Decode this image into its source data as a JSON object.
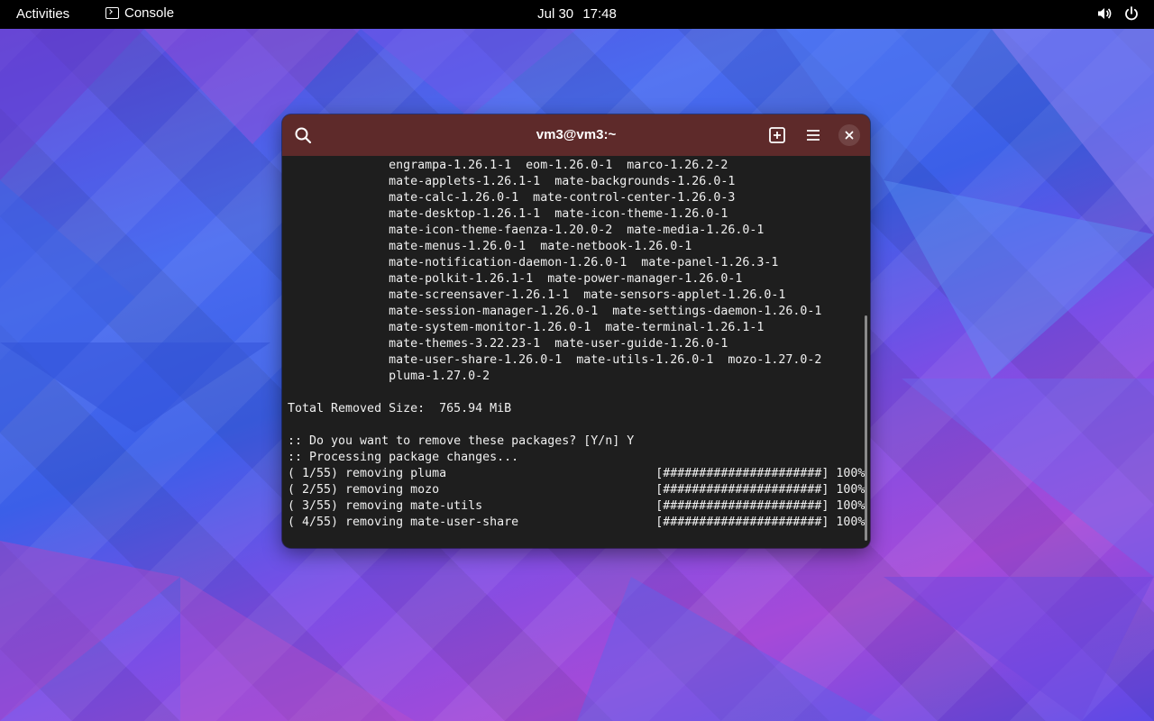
{
  "topbar": {
    "activities": "Activities",
    "app_name": "Console",
    "date": "Jul 30",
    "time": "17:48"
  },
  "icons": {
    "console": "terminal-icon",
    "volume": "speaker-icon",
    "power": "power-icon",
    "search": "magnifier-icon",
    "new_tab": "plus-square-icon",
    "menu": "hamburger-icon",
    "close": "x-icon"
  },
  "colors": {
    "headerbar": "#5e2a2a",
    "terminal_bg": "#1e1e1e",
    "terminal_fg": "#f0f0f0"
  },
  "window": {
    "title": "vm3@vm3:~"
  },
  "terminal": {
    "lines": [
      "              engrampa-1.26.1-1  eom-1.26.0-1  marco-1.26.2-2",
      "              mate-applets-1.26.1-1  mate-backgrounds-1.26.0-1",
      "              mate-calc-1.26.0-1  mate-control-center-1.26.0-3",
      "              mate-desktop-1.26.1-1  mate-icon-theme-1.26.0-1",
      "              mate-icon-theme-faenza-1.20.0-2  mate-media-1.26.0-1",
      "              mate-menus-1.26.0-1  mate-netbook-1.26.0-1",
      "              mate-notification-daemon-1.26.0-1  mate-panel-1.26.3-1",
      "              mate-polkit-1.26.1-1  mate-power-manager-1.26.0-1",
      "              mate-screensaver-1.26.1-1  mate-sensors-applet-1.26.0-1",
      "              mate-session-manager-1.26.0-1  mate-settings-daemon-1.26.0-1",
      "              mate-system-monitor-1.26.0-1  mate-terminal-1.26.1-1",
      "              mate-themes-3.22.23-1  mate-user-guide-1.26.0-1",
      "              mate-user-share-1.26.0-1  mate-utils-1.26.0-1  mozo-1.27.0-2",
      "              pluma-1.27.0-2",
      "",
      "Total Removed Size:  765.94 MiB",
      "",
      ":: Do you want to remove these packages? [Y/n] Y",
      ":: Processing package changes...",
      "( 1/55) removing pluma                             [######################] 100%",
      "( 2/55) removing mozo                              [######################] 100%",
      "( 3/55) removing mate-utils                        [######################] 100%",
      "( 4/55) removing mate-user-share                   [######################] 100%"
    ]
  }
}
